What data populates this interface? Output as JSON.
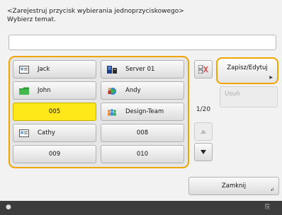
{
  "header": {
    "title": "<Zarejestruj przycisk wybierania jednoprzyciskowego>",
    "instruction": "Wybierz temat."
  },
  "name_field": {
    "value": ""
  },
  "keys": [
    {
      "label": "Jack",
      "icon": "address-card-icon",
      "selected": false
    },
    {
      "label": "Server 01",
      "icon": "server-icon",
      "selected": false
    },
    {
      "label": "John",
      "icon": "folder-icon",
      "selected": false
    },
    {
      "label": "Andy",
      "icon": "user-network-icon",
      "selected": false
    },
    {
      "label": "005",
      "icon": "",
      "selected": true
    },
    {
      "label": "Design-Team",
      "icon": "group-icon",
      "selected": false
    },
    {
      "label": "Cathy",
      "icon": "address-card-icon",
      "selected": false
    },
    {
      "label": "008",
      "icon": "",
      "selected": false
    },
    {
      "label": "009",
      "icon": "",
      "selected": false
    },
    {
      "label": "010",
      "icon": "",
      "selected": false
    }
  ],
  "pager": {
    "current": "1/20"
  },
  "buttons": {
    "save_edit": "Zapisz/Edytuj",
    "delete": "Usuń",
    "close": "Zamknij"
  },
  "colors": {
    "accent": "#f0a500",
    "selected": "#ffe81a",
    "status_bar": "#3c3c3c"
  }
}
